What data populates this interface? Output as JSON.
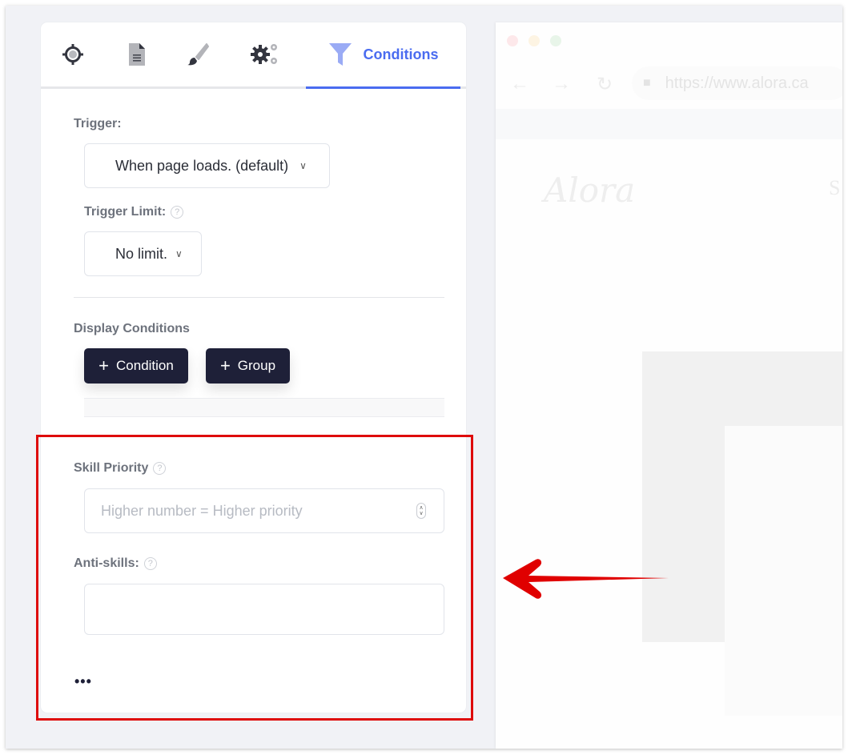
{
  "tabs": [
    {
      "icon": "target-icon",
      "label": ""
    },
    {
      "icon": "document-icon",
      "label": ""
    },
    {
      "icon": "brush-icon",
      "label": ""
    },
    {
      "icon": "gears-icon",
      "label": ""
    },
    {
      "icon": "filter-icon",
      "label": "Conditions",
      "active": true
    }
  ],
  "trigger": {
    "label": "Trigger:",
    "value": "When page loads. (default)"
  },
  "trigger_limit": {
    "label": "Trigger Limit:",
    "value": "No limit."
  },
  "display_conditions": {
    "label": "Display Conditions",
    "add_condition": "Condition",
    "add_group": "Group"
  },
  "skill_priority": {
    "label": "Skill Priority",
    "placeholder": "Higher number = Higher priority",
    "value": ""
  },
  "anti_skills": {
    "label": "Anti-skills:",
    "value": ""
  },
  "more_label": "•••",
  "help_glyph": "?",
  "preview": {
    "url": "https://www.alora.ca",
    "logo_text": "Alora",
    "nav_partial": "S"
  },
  "colors": {
    "accent": "#4a6cf0",
    "button_bg": "#1e2038",
    "annotation_red": "#de0b0b"
  }
}
